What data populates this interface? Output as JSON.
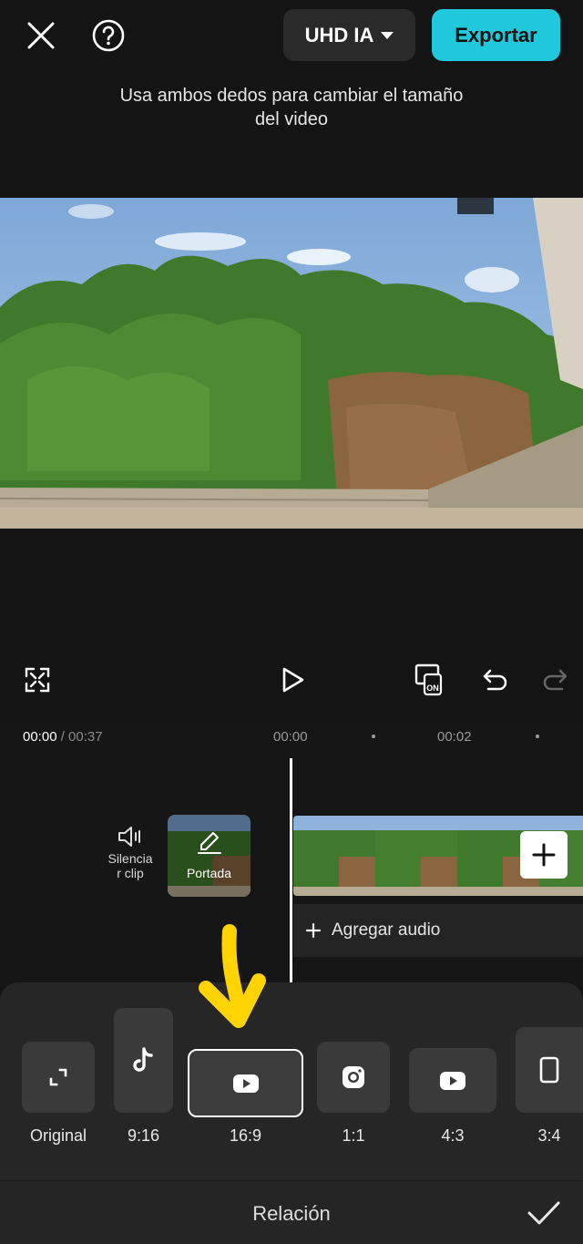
{
  "header": {
    "close_icon": "close-icon",
    "help_icon": "help-icon",
    "quality_label": "UHD IA",
    "export_label": "Exportar"
  },
  "hint": "Usa ambos dedos para cambiar el tamaño del video",
  "controls": {
    "fullscreen_icon": "fullscreen-icon",
    "play_icon": "play-icon",
    "keyframe_icon": "screen-on-icon",
    "undo_icon": "undo-icon",
    "redo_icon": "redo-icon"
  },
  "timeline": {
    "current_time": "00:00",
    "total_time": "/ 00:37",
    "tick_1": "00:00",
    "tick_2": "00:02",
    "mute_label": "Silenciar clip",
    "mute_label_line1": "Silencia",
    "mute_label_line2": "r clip",
    "cover_label": "Portada",
    "add_audio_label": "Agregar audio"
  },
  "ratios": [
    {
      "label": "Original",
      "icon": "expand-icon"
    },
    {
      "label": "9:16",
      "icon": "tiktok-icon"
    },
    {
      "label": "16:9",
      "icon": "youtube-icon",
      "selected": true
    },
    {
      "label": "1:1",
      "icon": "instagram-icon"
    },
    {
      "label": "4:3",
      "icon": "youtube-icon"
    },
    {
      "label": "3:4",
      "icon": "phone-icon"
    }
  ],
  "footer": {
    "title": "Relación",
    "confirm_icon": "check-icon"
  },
  "colors": {
    "accent": "#1fc9db",
    "arrow": "#ffd400",
    "background": "#141414",
    "panel": "#262626"
  }
}
